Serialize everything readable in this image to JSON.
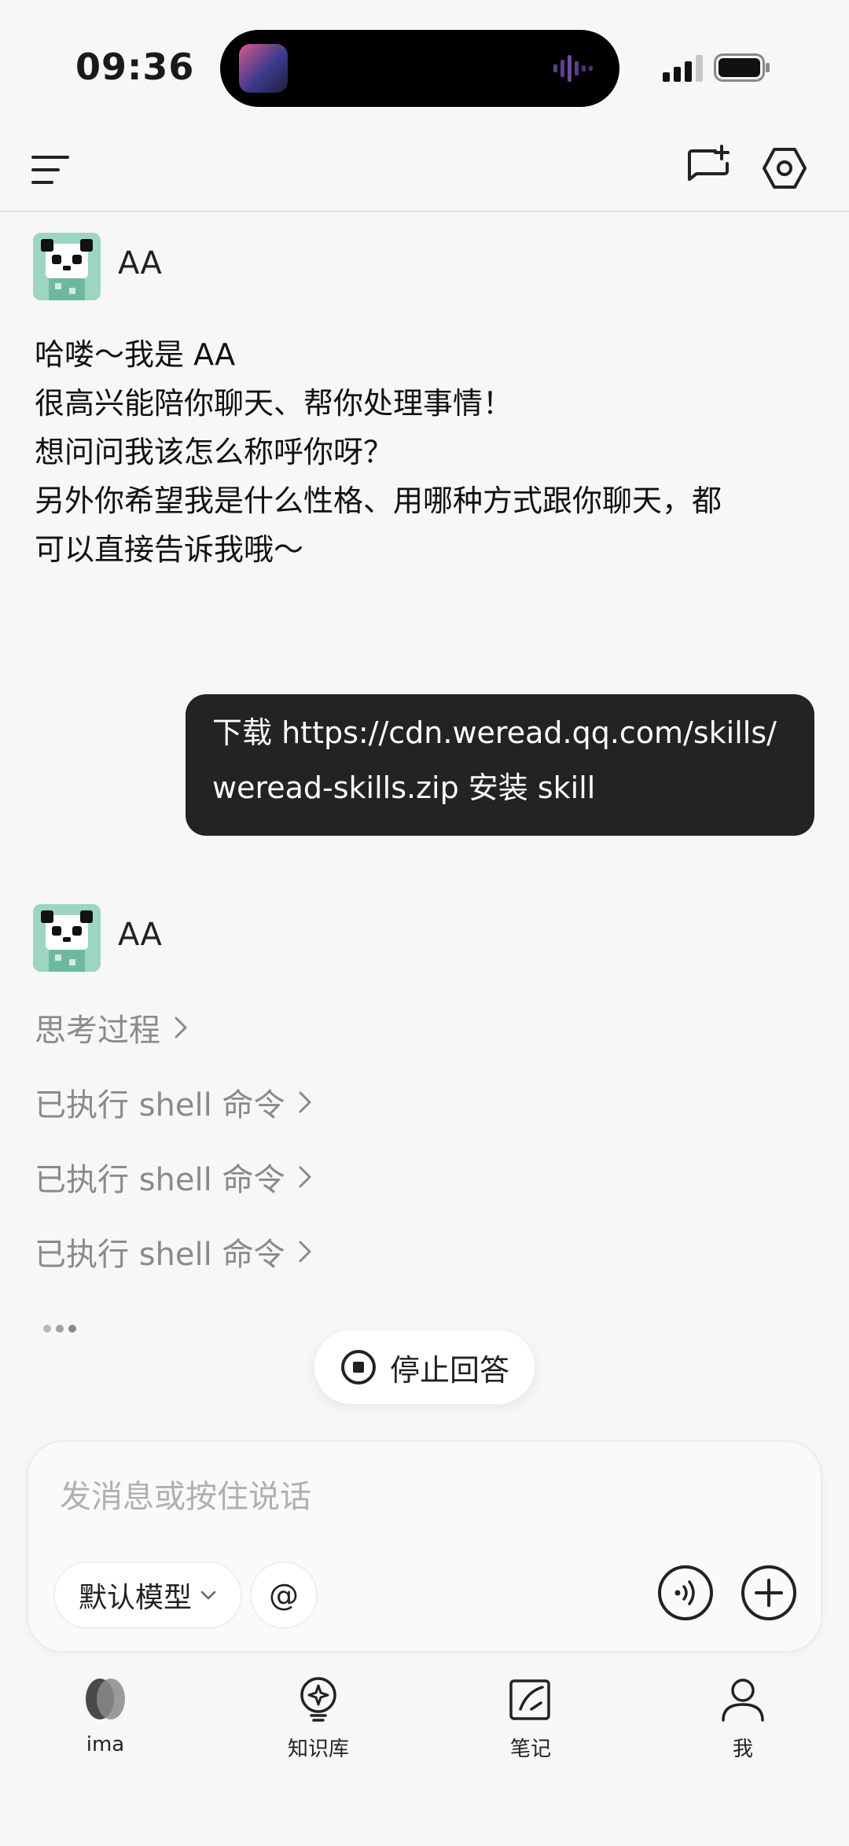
{
  "status_bar": {
    "time": "09:36"
  },
  "conversation": {
    "bot_name": "AA",
    "greeting_lines": [
      "哈喽～我是 AA",
      "很高兴能陪你聊天、帮你处理事情！",
      "想问问我该怎么称呼你呀？",
      "另外你希望我是什么性格、用哪种方式跟你聊天，都",
      "可以直接告诉我哦～"
    ],
    "user_message_lines": [
      "下载 https://cdn.weread.qq.com/skills/",
      "weread-skills.zip 安装 skill"
    ],
    "steps": [
      {
        "label": "思考过程"
      },
      {
        "label": "已执行 shell 命令"
      },
      {
        "label": "已执行 shell 命令"
      },
      {
        "label": "已执行 shell 命令"
      }
    ],
    "stop_label": "停止回答"
  },
  "composer": {
    "placeholder": "发消息或按住说话",
    "model_label": "默认模型",
    "mention_label": "@"
  },
  "tabs": [
    {
      "label": "ima",
      "icon": "ima-logo-icon"
    },
    {
      "label": "知识库",
      "icon": "knowledge-base-icon"
    },
    {
      "label": "笔记",
      "icon": "notes-icon"
    },
    {
      "label": "我",
      "icon": "profile-icon"
    }
  ],
  "colors": {
    "background": "#f7f7f7",
    "user_bubble": "#232323",
    "muted_text": "#8a8a8a",
    "avatar_bg": "#9dd6be"
  }
}
